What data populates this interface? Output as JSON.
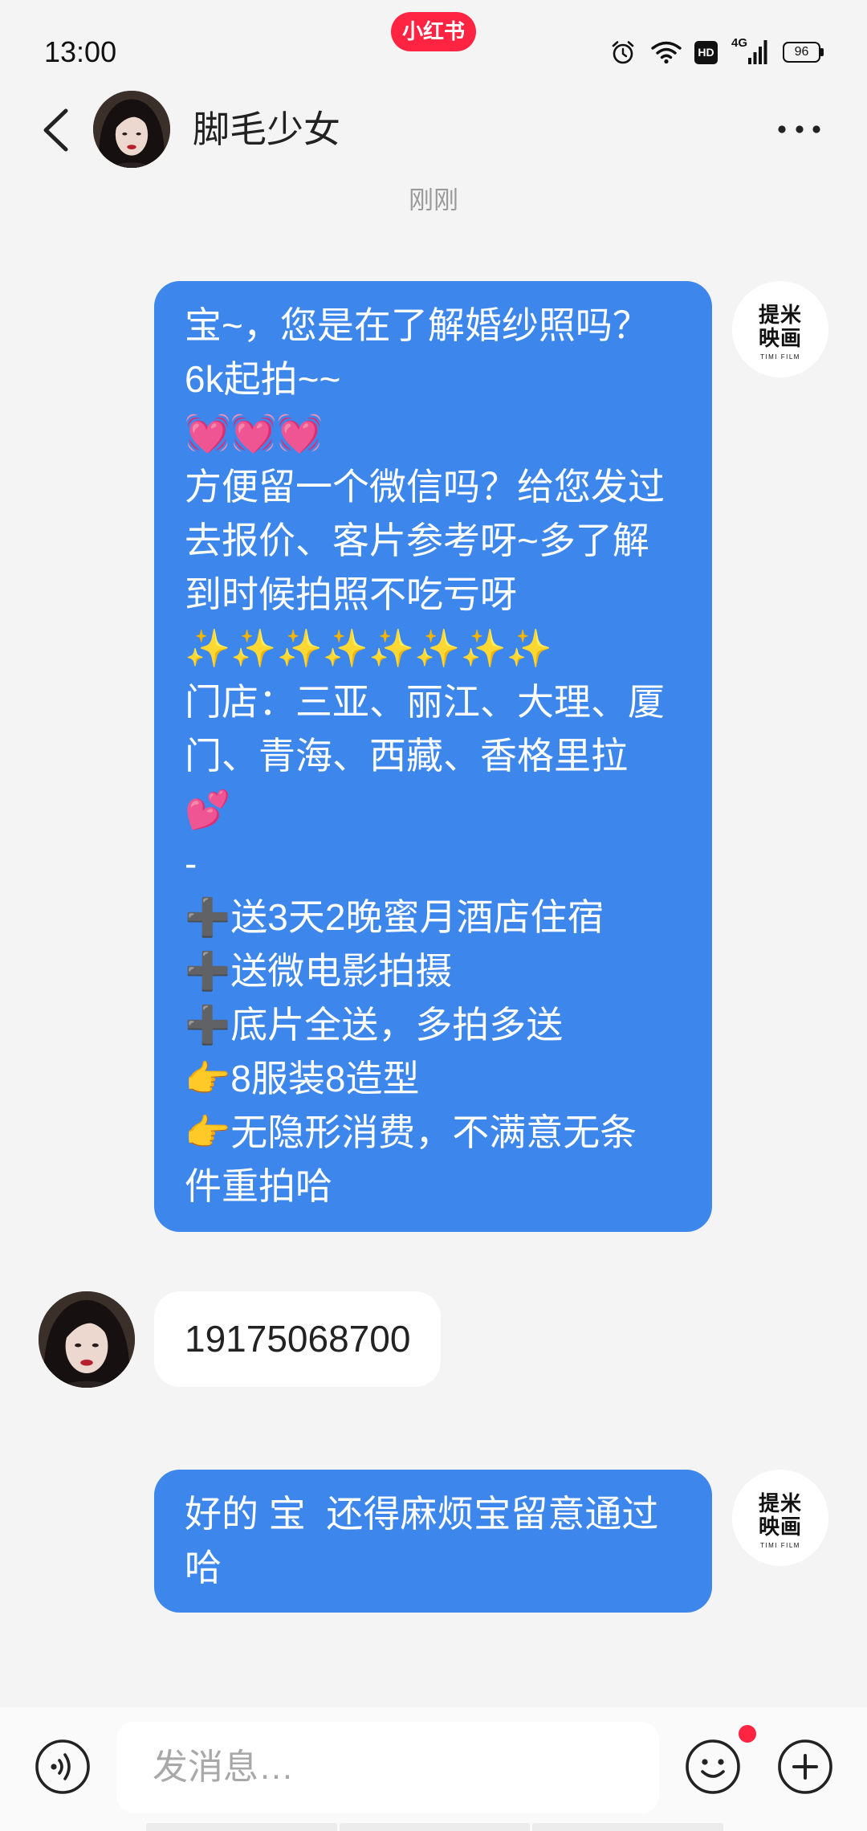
{
  "status_bar": {
    "time": "13:00",
    "app_badge": "小红书",
    "hd_label": "HD",
    "network_label": "4G",
    "battery_level": "96",
    "icons": [
      "alarm-icon",
      "wifi-icon",
      "hd-icon",
      "signal-icon",
      "battery-icon"
    ]
  },
  "header": {
    "contact_name": "脚毛少女",
    "back_icon": "chevron-left-icon",
    "more_icon": "more-horizontal-icon"
  },
  "self_avatar": {
    "line1": "提米",
    "line2": "映画",
    "tagline": "TIMI FILM"
  },
  "chat": {
    "timestamp": "刚刚",
    "messages": [
      {
        "from_self": true,
        "lines": [
          "宝~，您是在了解婚纱照吗？",
          "6k起拍~~",
          "💓💓💓",
          "方便留一个微信吗？给您发过",
          "去报价、客片参考呀~多了解",
          "到时候拍照不吃亏呀",
          "✨✨✨✨✨✨✨✨",
          "门店：三亚、丽江、大理、厦",
          "门、青海、西藏、香格里拉",
          "💕",
          "-",
          "➕送3天2晚蜜月酒店住宿",
          "➕送微电影拍摄",
          "➕底片全送，多拍多送",
          "👉8服装8造型",
          "👉无隐形消费，不满意无条",
          "件重拍哈"
        ]
      },
      {
        "from_self": false,
        "lines": [
          "19175068700"
        ]
      },
      {
        "from_self": true,
        "lines": [
          "好的 宝  还得麻烦宝留意通过",
          "哈"
        ]
      }
    ]
  },
  "input_bar": {
    "placeholder": "发消息…",
    "left_icon": "voice-icon",
    "right_icons": [
      "emoji-icon",
      "plus-icon"
    ],
    "emoji_notification_dot": true
  },
  "colors": {
    "brand_red": "#ff2442",
    "sent_bubble": "#3d86ec",
    "received_bubble": "#ffffff",
    "page_background": "#f4f4f5"
  }
}
